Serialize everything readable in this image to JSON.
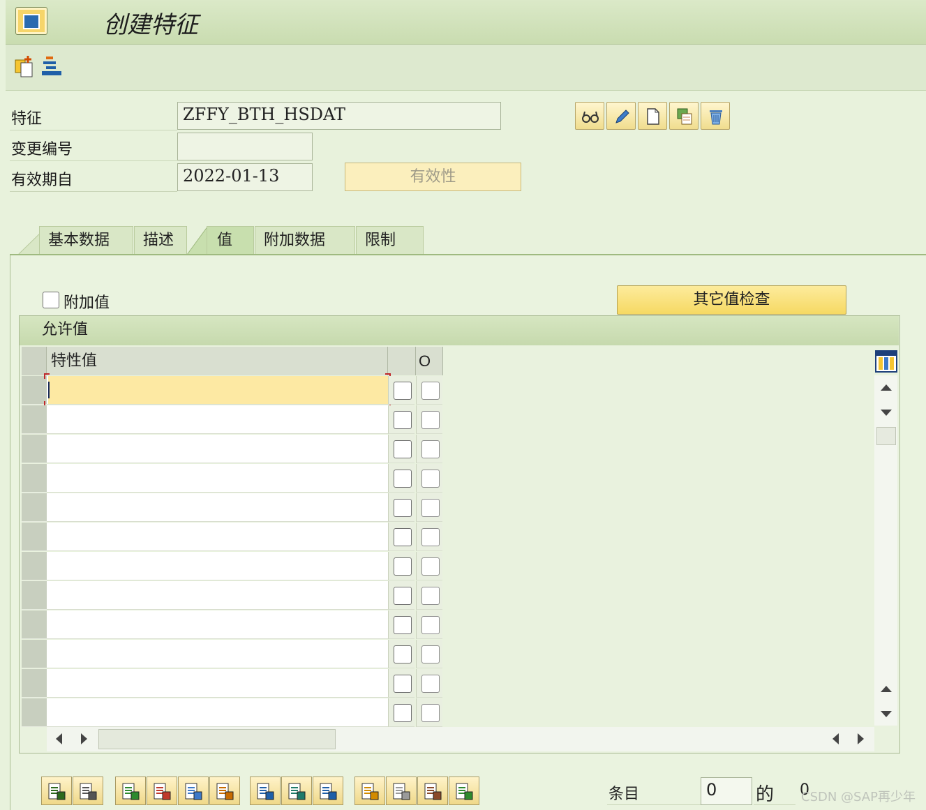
{
  "window": {
    "title": "创建特征"
  },
  "form": {
    "feature_label": "特征",
    "feature_value": "ZFFY_BTH_HSDAT",
    "change_no_label": "变更编号",
    "change_no_value": "",
    "valid_from_label": "有效期自",
    "valid_from_value": "2022-01-13",
    "validity_button": "有效性"
  },
  "tabs": [
    {
      "label": "基本数据",
      "active": false
    },
    {
      "label": "描述",
      "active": false
    },
    {
      "label": "值",
      "active": true
    },
    {
      "label": "附加数据",
      "active": false
    },
    {
      "label": "限制",
      "active": false
    }
  ],
  "values_tab": {
    "additional_values_label": "附加值",
    "additional_values_checked": false,
    "other_value_check_button": "其它值检查",
    "grid_title": "允许值",
    "col_value": "特性值",
    "col_o": "O",
    "rows": [
      "",
      "",
      "",
      "",
      "",
      "",
      "",
      "",
      "",
      "",
      "",
      ""
    ]
  },
  "footer": {
    "entries_label": "条目",
    "current": "0",
    "of_label": "的",
    "total": "0",
    "watermark": "CSDN @SAP再少年"
  },
  "colors": {
    "accent_green": "#c8dfae",
    "button_yellow": "#f6d963",
    "focus_yellow": "#fde9a3"
  },
  "icons": [
    "app-icon",
    "create-icon",
    "hierarchy-icon",
    "glasses-icon",
    "pencil-icon",
    "new-doc-icon",
    "copy-icon",
    "trash-icon",
    "column-settings-icon"
  ]
}
